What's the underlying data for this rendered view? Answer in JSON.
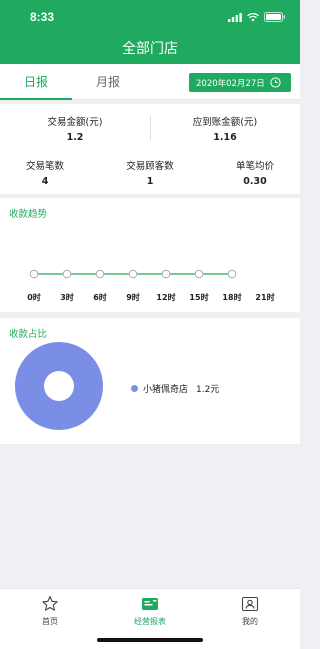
{
  "status_bar": {
    "time": "8:33"
  },
  "header": {
    "title": "全部门店"
  },
  "tabs": [
    {
      "label": "日报"
    },
    {
      "label": "月报"
    }
  ],
  "date_picker": {
    "date": "2020年02月27日"
  },
  "summary": {
    "transaction_amount": {
      "label": "交易金额(元)",
      "value": "1.2"
    },
    "receivable_amount": {
      "label": "应到账金额(元)",
      "value": "1.16"
    },
    "transaction_count": {
      "label": "交易笔数",
      "value": "4"
    },
    "customer_count": {
      "label": "交易顾客数",
      "value": "1"
    },
    "avg_price": {
      "label": "单笔均价",
      "value": "0.30"
    }
  },
  "trend": {
    "title": "收款趋势",
    "ticks": [
      "0时",
      "3时",
      "6时",
      "9时",
      "12时",
      "15时",
      "18时",
      "21时"
    ]
  },
  "ratio": {
    "title": "收款占比",
    "legend": [
      {
        "name": "小猪佩奇店",
        "amount": "1.2元",
        "color": "#7a8ee6"
      }
    ]
  },
  "bottom_nav": [
    {
      "label": "首页"
    },
    {
      "label": "经营报表"
    },
    {
      "label": "我的"
    }
  ],
  "colors": {
    "accent": "#1faa5f",
    "donut": "#7a8ee6"
  }
}
